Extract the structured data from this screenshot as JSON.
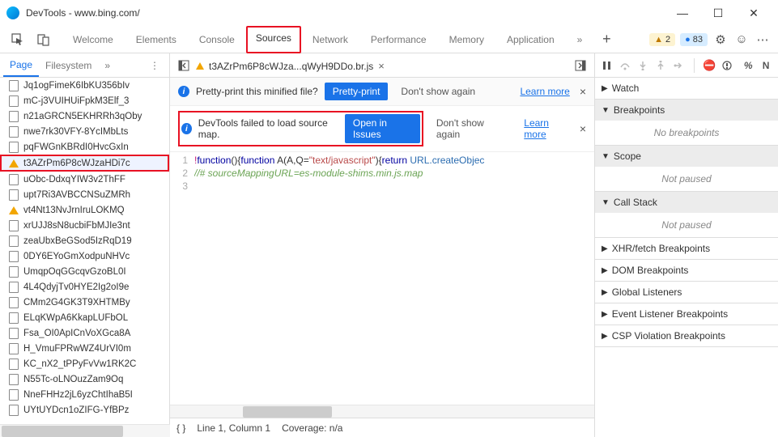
{
  "window": {
    "title": "DevTools - www.bing.com/"
  },
  "main_tabs": [
    "Welcome",
    "Elements",
    "Console",
    "Sources",
    "Network",
    "Performance",
    "Memory",
    "Application"
  ],
  "main_tab_active": "Sources",
  "badges": {
    "warn": "2",
    "msg": "83"
  },
  "left_tabs": [
    "Page",
    "Filesystem"
  ],
  "left_tab_active": "Page",
  "files": [
    {
      "name": "Jq1ogFimeK6IbKU356bIv",
      "icon": "doc"
    },
    {
      "name": "mC-j3VUIHUiFpkM3Elf_3",
      "icon": "doc"
    },
    {
      "name": "n21aGRCN5EKHRRh3qOby",
      "icon": "doc"
    },
    {
      "name": "nwe7rk30VFY-8YcIMbLts",
      "icon": "doc"
    },
    {
      "name": "pqFWGnKBRdI0HvcGxIn",
      "icon": "doc"
    },
    {
      "name": "t3AZrPm6P8cWJzaHDi7c",
      "icon": "warn",
      "hl": true
    },
    {
      "name": "uObc-DdxqYIW3v2ThFF",
      "icon": "doc"
    },
    {
      "name": "upt7Ri3AVBCCNSuZMRh",
      "icon": "doc"
    },
    {
      "name": "vt4Nt13NvJrnIruLOKMQ",
      "icon": "warn"
    },
    {
      "name": "xrUJJ8sN8ucbiFbMJIe3nt",
      "icon": "doc"
    },
    {
      "name": "zeaUbxBeGSod5IzRqD19",
      "icon": "doc"
    },
    {
      "name": "0DY6EYoGmXodpuNHVc",
      "icon": "doc"
    },
    {
      "name": "UmqpOqGGcqvGzoBL0I",
      "icon": "doc"
    },
    {
      "name": "4L4QdyjTv0HYE2Ig2oI9e",
      "icon": "doc"
    },
    {
      "name": "CMm2G4GK3T9XHTMBy",
      "icon": "doc"
    },
    {
      "name": "ELqKWpA6KkapLUFbOL",
      "icon": "doc"
    },
    {
      "name": "Fsa_OI0ApICnVoXGca8A",
      "icon": "doc"
    },
    {
      "name": "H_VmuFPRwWZ4UrVI0m",
      "icon": "doc"
    },
    {
      "name": "KC_nX2_tPPyFvVw1RK2C",
      "icon": "doc"
    },
    {
      "name": "N55Tc-oLNOuzZam9Oq",
      "icon": "doc"
    },
    {
      "name": "NneFHHz2jL6yzChtIhaB5I",
      "icon": "doc"
    },
    {
      "name": "UYtUYDcn1oZIFG-YfBPz",
      "icon": "doc"
    }
  ],
  "open_file": {
    "name": "t3AZrPm6P8cWJza...qWyH9DDo.br.js"
  },
  "banner1": {
    "text": "Pretty-print this minified file?",
    "btn": "Pretty-print",
    "dismiss": "Don't show again",
    "learn": "Learn more"
  },
  "banner2": {
    "text": "DevTools failed to load source map.",
    "btn": "Open in Issues",
    "dismiss": "Don't show again",
    "learn": "Learn more"
  },
  "code": {
    "lines": [
      "1",
      "2",
      "3"
    ],
    "l1_a": "!",
    "l1_b": "function",
    "l1_c": "(){",
    "l1_d": "function",
    "l1_e": " A(A,Q=",
    "l1_f": "\"text/javascript\"",
    "l1_g": "){",
    "l1_h": "return",
    "l1_i": " URL.createObjec",
    "l2": "//# sourceMappingURL=es-module-shims.min.js.map"
  },
  "status": {
    "pos": "Line 1, Column 1",
    "cov": "Coverage: n/a"
  },
  "debug_sections": [
    "Watch",
    "Breakpoints",
    "Scope",
    "Call Stack",
    "XHR/fetch Breakpoints",
    "DOM Breakpoints",
    "Global Listeners",
    "Event Listener Breakpoints",
    "CSP Violation Breakpoints"
  ],
  "debug_bodies": {
    "breakpoints": "No breakpoints",
    "scope": "Not paused",
    "callstack": "Not paused"
  }
}
